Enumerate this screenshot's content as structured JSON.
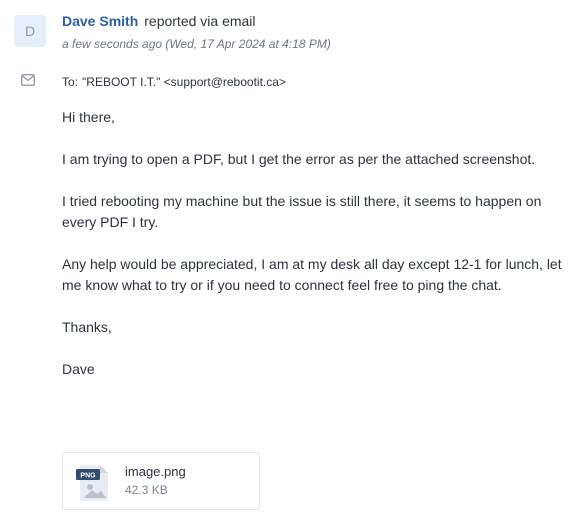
{
  "sender": {
    "initial": "D",
    "name": "Dave Smith",
    "action": "reported via email",
    "timestamp": "a few seconds ago (Wed, 17 Apr 2024 at 4:18 PM)"
  },
  "recipient": {
    "label": "To:",
    "value": "\"REBOOT I.T.\" <support@rebootit.ca>"
  },
  "message": {
    "paragraphs": [
      "Hi there,",
      "I am trying to open a PDF, but I get the error as per the attached screenshot.",
      "I tried rebooting my machine but the issue is still there, it seems to happen on every PDF I try.",
      "Any help would be appreciated, I am at my desk all day except 12-1 for lunch, let me know what to try or if you need to connect feel free to ping the chat.",
      "Thanks,",
      "Dave"
    ]
  },
  "attachment": {
    "badge": "PNG",
    "name": "image.png",
    "size": "42.3 KB",
    "icon": "image-file-icon"
  },
  "colors": {
    "accent": "#2c5ea8",
    "avatar_bg": "#e6eef9",
    "text": "#2b3440",
    "muted": "#6b7685"
  }
}
